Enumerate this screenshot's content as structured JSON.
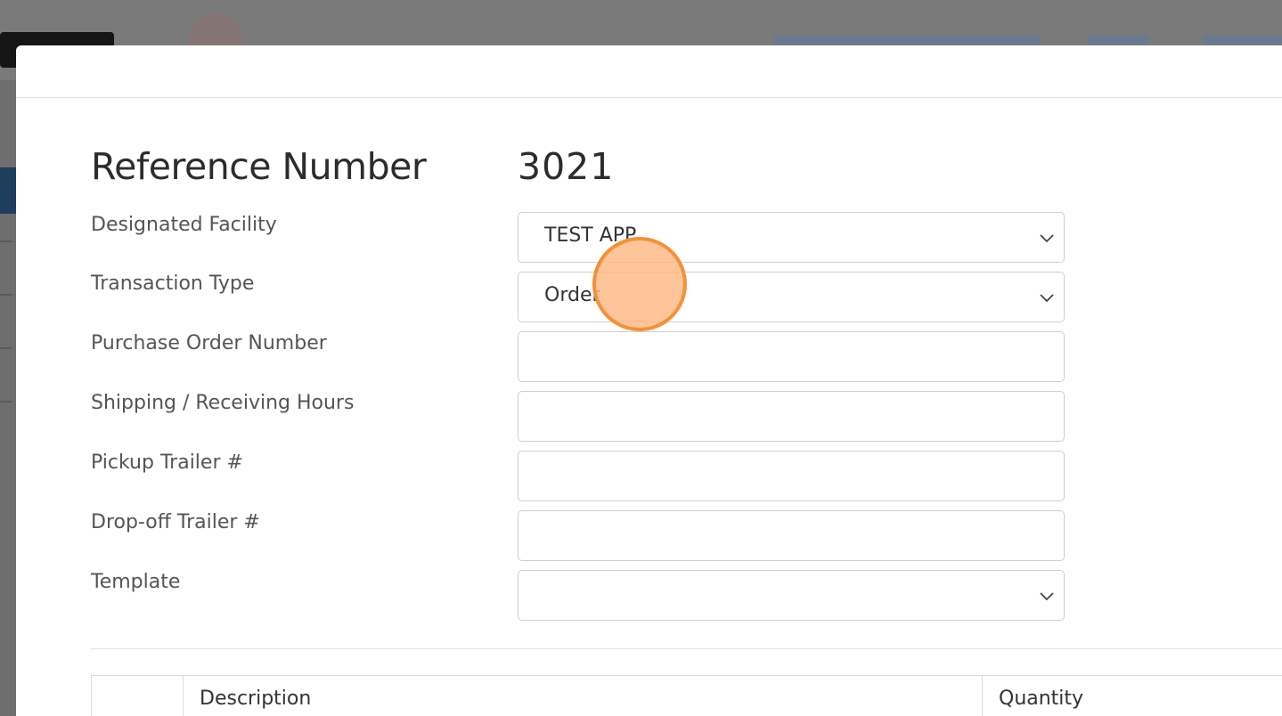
{
  "modal": {
    "reference_label": "Reference Number",
    "reference_value": "3021",
    "fields": [
      {
        "label": "Designated Facility",
        "value": "TEST APP",
        "type": "select"
      },
      {
        "label": "Transaction Type",
        "value": "Order",
        "type": "select"
      },
      {
        "label": "Purchase Order Number",
        "value": "",
        "type": "text"
      },
      {
        "label": "Shipping / Receiving Hours",
        "value": "",
        "type": "text"
      },
      {
        "label": "Pickup Trailer #",
        "value": "",
        "type": "text"
      },
      {
        "label": "Drop-off Trailer #",
        "value": "",
        "type": "text"
      },
      {
        "label": "Template",
        "value": "",
        "type": "select"
      }
    ],
    "table": {
      "headers": [
        "",
        "Description",
        "Quantity"
      ]
    }
  },
  "icons": {
    "select_arrow": "chevron-down-icon",
    "click_marker": "click-indicator"
  },
  "colors": {
    "overlay": "#808080",
    "click_fill": "#fdb882",
    "click_border": "#f39138"
  }
}
